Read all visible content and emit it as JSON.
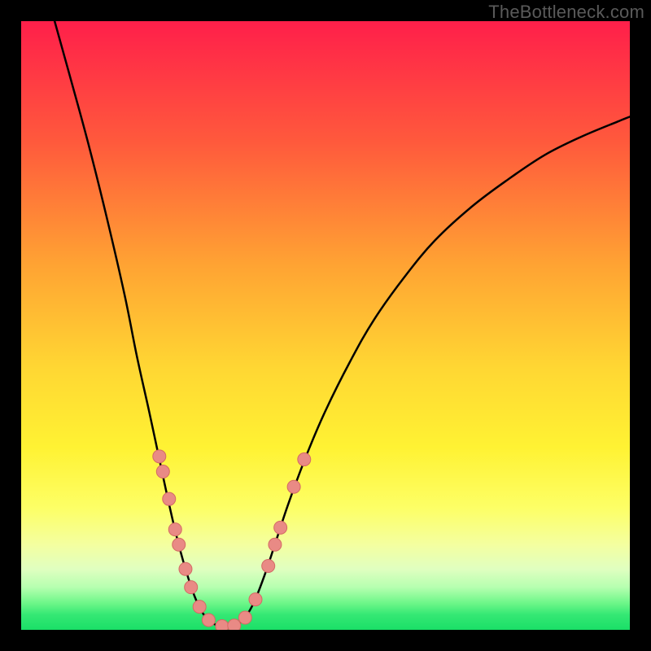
{
  "watermark": "TheBottleneck.com",
  "colors": {
    "frame": "#000000",
    "curve": "#000000",
    "marker_fill": "#e98a85",
    "marker_stroke": "#d46a64",
    "gradient_stops": [
      {
        "offset": 0.0,
        "color": "#ff1f4a"
      },
      {
        "offset": 0.2,
        "color": "#ff5a3c"
      },
      {
        "offset": 0.4,
        "color": "#ffa333"
      },
      {
        "offset": 0.57,
        "color": "#ffd733"
      },
      {
        "offset": 0.7,
        "color": "#fff233"
      },
      {
        "offset": 0.8,
        "color": "#fdff66"
      },
      {
        "offset": 0.86,
        "color": "#f4ffa0"
      },
      {
        "offset": 0.9,
        "color": "#e0ffc0"
      },
      {
        "offset": 0.93,
        "color": "#b6ffb0"
      },
      {
        "offset": 0.955,
        "color": "#70f78a"
      },
      {
        "offset": 0.975,
        "color": "#35e874"
      },
      {
        "offset": 1.0,
        "color": "#1adf67"
      }
    ]
  },
  "chart_data": {
    "type": "line",
    "title": "",
    "xlabel": "",
    "ylabel": "",
    "xlim": [
      0,
      100
    ],
    "ylim": [
      0,
      100
    ],
    "curves": [
      {
        "name": "left-branch",
        "points": [
          {
            "x": 5.5,
            "y": 100
          },
          {
            "x": 8,
            "y": 91
          },
          {
            "x": 11,
            "y": 80
          },
          {
            "x": 14,
            "y": 68
          },
          {
            "x": 17,
            "y": 55
          },
          {
            "x": 19,
            "y": 45
          },
          {
            "x": 21,
            "y": 36
          },
          {
            "x": 22.5,
            "y": 29
          },
          {
            "x": 24,
            "y": 22
          },
          {
            "x": 25.5,
            "y": 15.5
          },
          {
            "x": 27,
            "y": 10
          },
          {
            "x": 28.5,
            "y": 5.5
          },
          {
            "x": 30,
            "y": 2.5
          },
          {
            "x": 32,
            "y": 0.8
          },
          {
            "x": 34,
            "y": 0.5
          }
        ]
      },
      {
        "name": "right-branch",
        "points": [
          {
            "x": 34,
            "y": 0.5
          },
          {
            "x": 36,
            "y": 1.2
          },
          {
            "x": 38,
            "y": 4
          },
          {
            "x": 40,
            "y": 9
          },
          {
            "x": 42,
            "y": 15
          },
          {
            "x": 44,
            "y": 21
          },
          {
            "x": 47,
            "y": 29
          },
          {
            "x": 50,
            "y": 36
          },
          {
            "x": 54,
            "y": 44
          },
          {
            "x": 58,
            "y": 51
          },
          {
            "x": 63,
            "y": 58
          },
          {
            "x": 68,
            "y": 64
          },
          {
            "x": 74,
            "y": 69.5
          },
          {
            "x": 80,
            "y": 74
          },
          {
            "x": 86,
            "y": 78
          },
          {
            "x": 92,
            "y": 81
          },
          {
            "x": 98,
            "y": 83.5
          },
          {
            "x": 100,
            "y": 84.3
          }
        ]
      }
    ],
    "markers": [
      {
        "x": 22.7,
        "y": 28.5
      },
      {
        "x": 23.3,
        "y": 26.0
      },
      {
        "x": 24.3,
        "y": 21.5
      },
      {
        "x": 25.3,
        "y": 16.5
      },
      {
        "x": 25.9,
        "y": 14.0
      },
      {
        "x": 27.0,
        "y": 10.0
      },
      {
        "x": 27.9,
        "y": 7.0
      },
      {
        "x": 29.3,
        "y": 3.8
      },
      {
        "x": 30.8,
        "y": 1.6
      },
      {
        "x": 33.0,
        "y": 0.6
      },
      {
        "x": 35.0,
        "y": 0.7
      },
      {
        "x": 36.8,
        "y": 2.0
      },
      {
        "x": 38.5,
        "y": 5.0
      },
      {
        "x": 40.6,
        "y": 10.5
      },
      {
        "x": 41.7,
        "y": 14.0
      },
      {
        "x": 42.6,
        "y": 16.8
      },
      {
        "x": 44.8,
        "y": 23.5
      },
      {
        "x": 46.5,
        "y": 28.0
      }
    ],
    "marker_radius_px": 8
  }
}
